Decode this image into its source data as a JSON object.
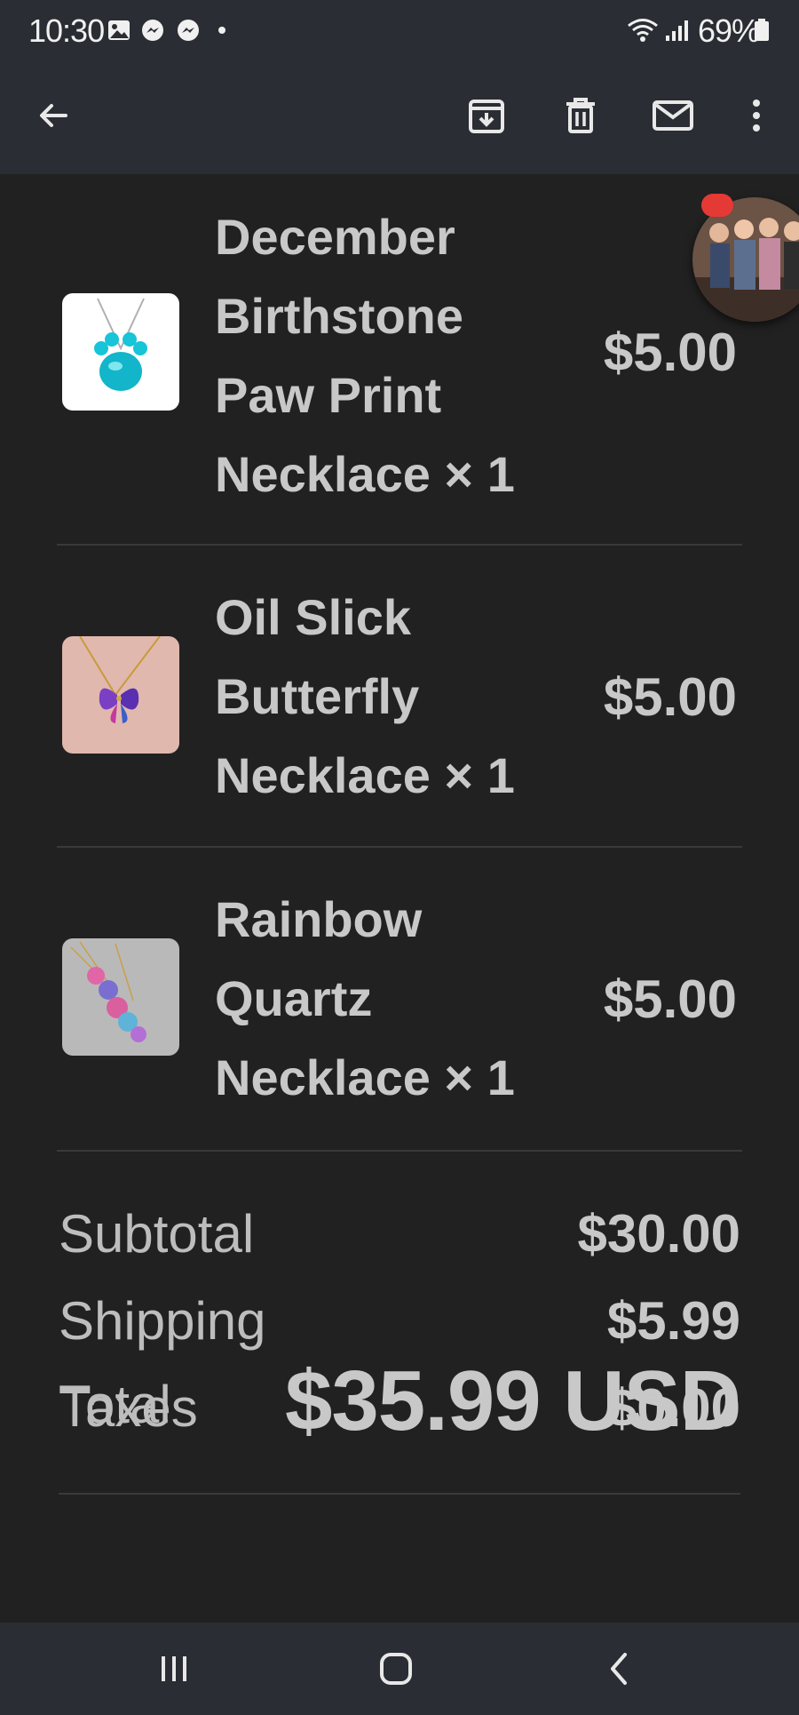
{
  "status_bar": {
    "time": "10:30",
    "battery_percent": "69%",
    "icons": [
      "gallery-icon",
      "messenger-icon",
      "messenger-icon",
      "dot-icon",
      "wifi-icon",
      "signal-icon",
      "battery-icon"
    ]
  },
  "app_bar": {
    "actions": [
      "back-arrow-icon",
      "archive-icon",
      "delete-icon",
      "mark-unread-icon",
      "more-vert-icon"
    ]
  },
  "order": {
    "items": [
      {
        "name": "December\nBirthstone\nPaw Print\nNecklace × 1",
        "price": "$5.00",
        "image": "blue-paw-necklace"
      },
      {
        "name": "Oil Slick\nButterfly\nNecklace × 1",
        "price": "$5.00",
        "image": "butterfly-necklace"
      },
      {
        "name": "Rainbow\nQuartz\nNecklace × 1",
        "price": "$5.00",
        "image": "rainbow-quartz-necklace"
      }
    ],
    "summary": [
      {
        "label": "Subtotal",
        "value": "$30.00"
      },
      {
        "label": "Shipping",
        "value": "$5.99"
      },
      {
        "label": "Taxes",
        "value": "$0.00"
      }
    ],
    "total_label": "Total",
    "total_value": "$35.99 USD"
  },
  "nav_bar": {
    "buttons": [
      "recent-apps-icon",
      "home-icon",
      "back-icon"
    ]
  },
  "colors": {
    "background": "#212121",
    "bars": "#2a2d33",
    "text": "#c8c8c8",
    "badge": "#e53935"
  }
}
